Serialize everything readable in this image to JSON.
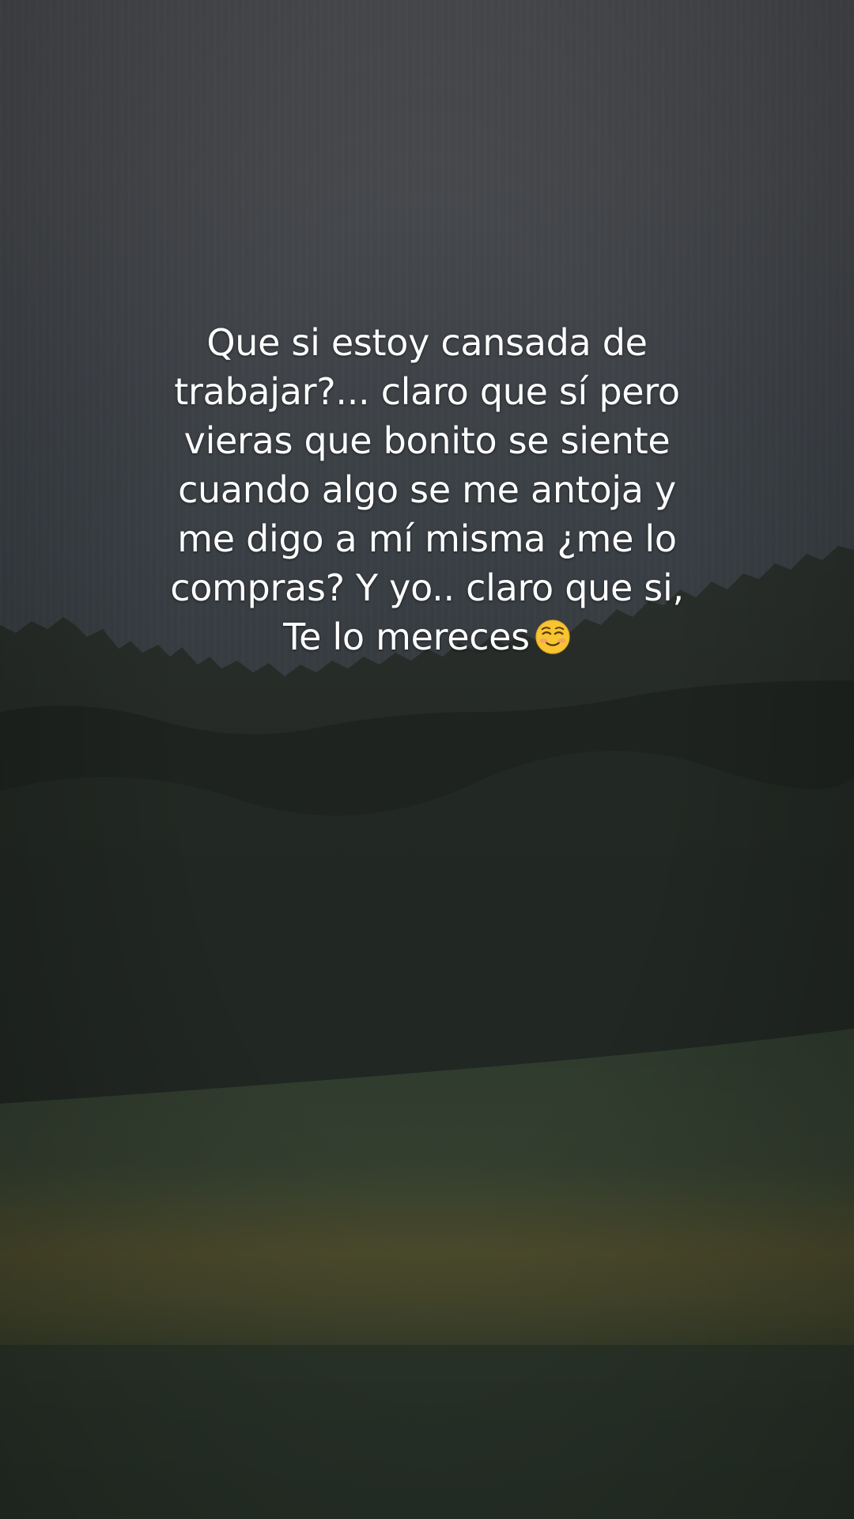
{
  "caption": {
    "lines": [
      "Que si estoy cansada de",
      "trabajar?... claro que sí pero",
      "vieras que bonito se siente",
      "cuando algo se me antoja y",
      "me digo a mí misma ¿me lo",
      "compras? Y yo.. claro que si,",
      "Te lo mereces"
    ],
    "emoji": "smiling-face-icon"
  },
  "scene": {
    "sky_color": "#45484c",
    "tree_color": "#1f2420",
    "field_color": "#2f3a2c",
    "field_gold": "#4a4a2a"
  }
}
